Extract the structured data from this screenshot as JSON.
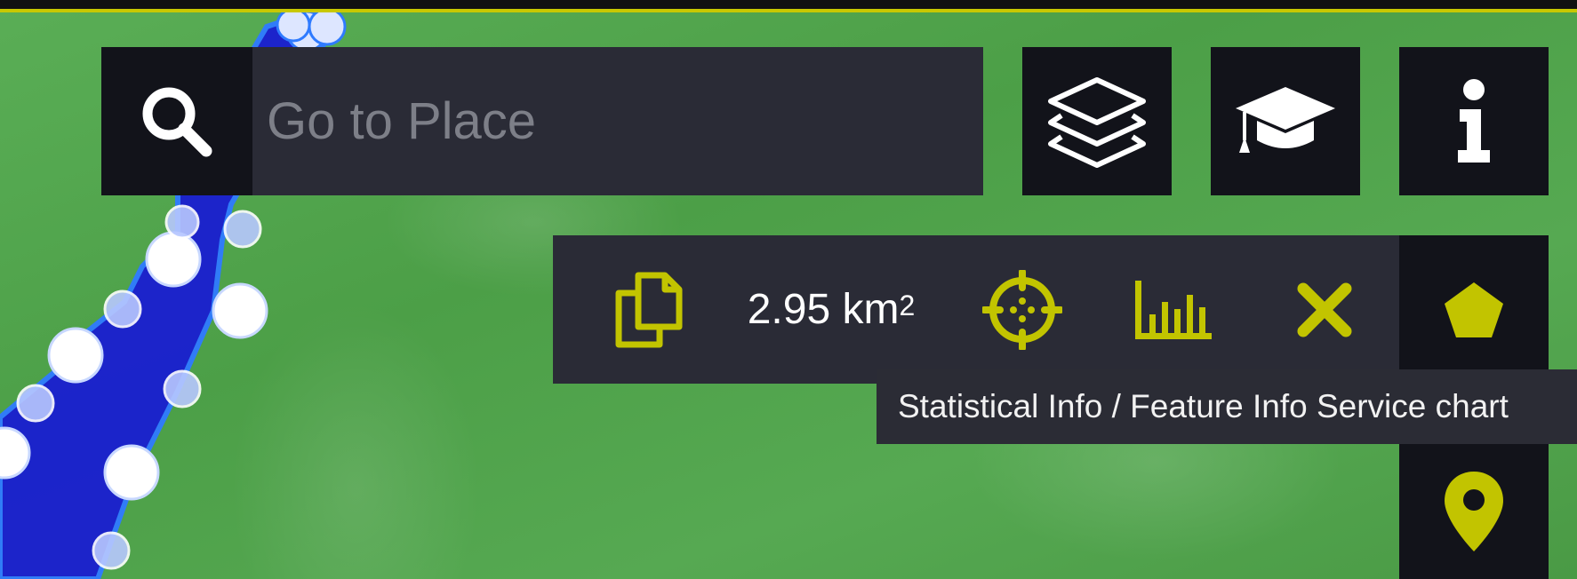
{
  "search": {
    "placeholder": "Go to Place"
  },
  "measure": {
    "area_value": "2.95 km",
    "area_unit_exponent": "2"
  },
  "tooltip": {
    "text": "Statistical Info / Feature Info Service chart"
  },
  "colors": {
    "accent": "#c2c400",
    "panel": "#2a2b36",
    "button": "#12131a",
    "water": "#1a1fd0"
  },
  "icons": [
    "search-icon",
    "layers-icon",
    "graduation-cap-icon",
    "info-icon",
    "copy-icon",
    "crosshair-icon",
    "bar-chart-icon",
    "close-icon",
    "polygon-icon",
    "map-marker-icon"
  ]
}
